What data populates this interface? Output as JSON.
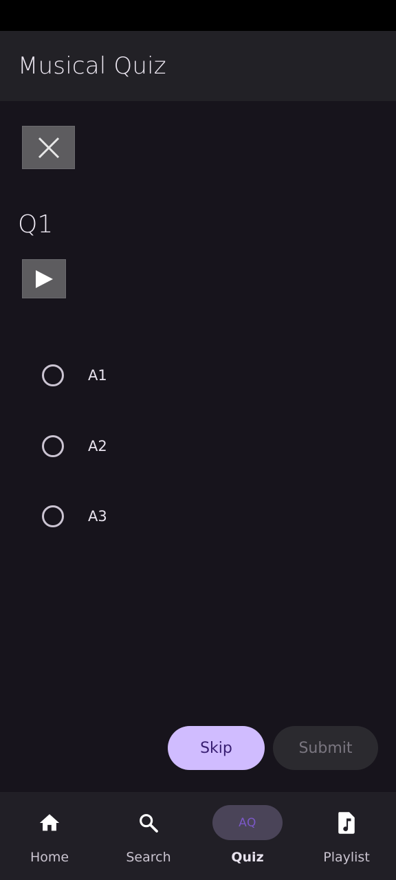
{
  "app_bar": {
    "title": "Musical Quiz"
  },
  "quiz": {
    "question": "Q1",
    "options": [
      {
        "label": "A1",
        "selected": false
      },
      {
        "label": "A2",
        "selected": false
      },
      {
        "label": "A3",
        "selected": false
      }
    ]
  },
  "actions": {
    "skip_label": "Skip",
    "submit_label": "Submit"
  },
  "bottom_nav": {
    "items": [
      {
        "label": "Home",
        "icon": "home-icon",
        "active": false
      },
      {
        "label": "Search",
        "icon": "search-icon",
        "active": false
      },
      {
        "label": "Quiz",
        "icon": "AQ",
        "active": true
      },
      {
        "label": "Playlist",
        "icon": "music-file-icon",
        "active": false
      }
    ]
  },
  "colors": {
    "background": "#17141c",
    "app_bar": "#222126",
    "skip_button": "#d0bcff",
    "submit_button": "#2b2a2f",
    "nav_active_indicator": "#4a4458"
  }
}
